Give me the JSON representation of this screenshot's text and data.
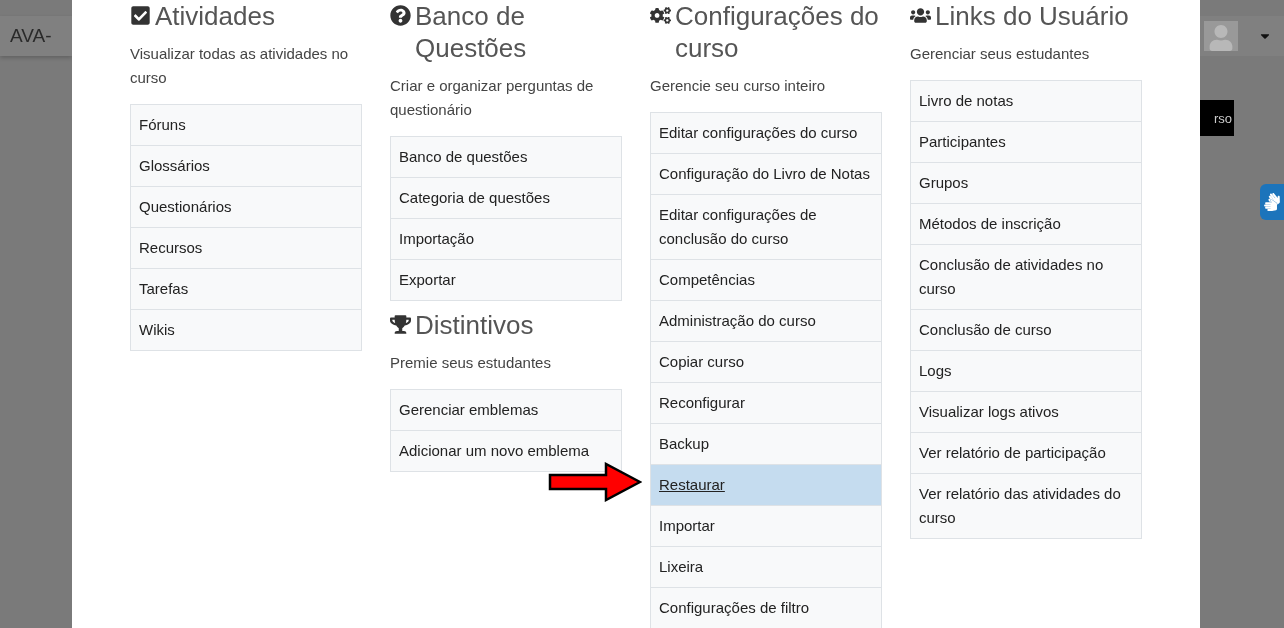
{
  "header": {
    "site_title": "AVA-"
  },
  "background_badge": "rso",
  "columns": [
    {
      "sections": [
        {
          "kind": "checkbox",
          "title": "Atividades",
          "description": "Visualizar todas as atividades no curso",
          "items": [
            {
              "label": "Fóruns",
              "selected": false
            },
            {
              "label": "Glossários",
              "selected": false
            },
            {
              "label": "Questionários",
              "selected": false
            },
            {
              "label": "Recursos",
              "selected": false
            },
            {
              "label": "Tarefas",
              "selected": false
            },
            {
              "label": "Wikis",
              "selected": false
            }
          ]
        }
      ]
    },
    {
      "sections": [
        {
          "kind": "question",
          "title": "Banco de Questões",
          "description": "Criar e organizar perguntas de questionário",
          "items": [
            {
              "label": "Banco de questões",
              "selected": false
            },
            {
              "label": "Categoria de questões",
              "selected": false
            },
            {
              "label": "Importação",
              "selected": false
            },
            {
              "label": "Exportar",
              "selected": false
            }
          ]
        },
        {
          "kind": "trophy",
          "title": "Distintivos",
          "description": "Premie seus estudantes",
          "items": [
            {
              "label": "Gerenciar emblemas",
              "selected": false
            },
            {
              "label": "Adicionar um novo emblema",
              "selected": false
            }
          ]
        }
      ]
    },
    {
      "sections": [
        {
          "kind": "gears",
          "title": "Configurações do curso",
          "description": "Gerencie seu curso inteiro",
          "items": [
            {
              "label": "Editar configurações do curso",
              "selected": false
            },
            {
              "label": "Configuração do Livro de Notas",
              "selected": false
            },
            {
              "label": "Editar configurações de conclusão do curso",
              "selected": false
            },
            {
              "label": "Competências",
              "selected": false
            },
            {
              "label": "Administração do curso",
              "selected": false
            },
            {
              "label": "Copiar curso",
              "selected": false
            },
            {
              "label": "Reconfigurar",
              "selected": false
            },
            {
              "label": "Backup",
              "selected": false
            },
            {
              "label": "Restaurar",
              "selected": true
            },
            {
              "label": "Importar",
              "selected": false
            },
            {
              "label": "Lixeira",
              "selected": false
            },
            {
              "label": "Configurações de filtro",
              "selected": false
            }
          ]
        }
      ]
    },
    {
      "sections": [
        {
          "kind": "users",
          "title": "Links do Usuário",
          "description": "Gerenciar seus estudantes",
          "items": [
            {
              "label": "Livro de notas",
              "selected": false
            },
            {
              "label": "Participantes",
              "selected": false
            },
            {
              "label": "Grupos",
              "selected": false
            },
            {
              "label": "Métodos de inscrição",
              "selected": false
            },
            {
              "label": "Conclusão de atividades no curso",
              "selected": false
            },
            {
              "label": "Conclusão de curso",
              "selected": false
            },
            {
              "label": "Logs",
              "selected": false
            },
            {
              "label": "Visualizar logs ativos",
              "selected": false
            },
            {
              "label": "Ver relatório de participação",
              "selected": false
            },
            {
              "label": "Ver relatório das atividades do curso",
              "selected": false
            }
          ]
        }
      ]
    }
  ]
}
